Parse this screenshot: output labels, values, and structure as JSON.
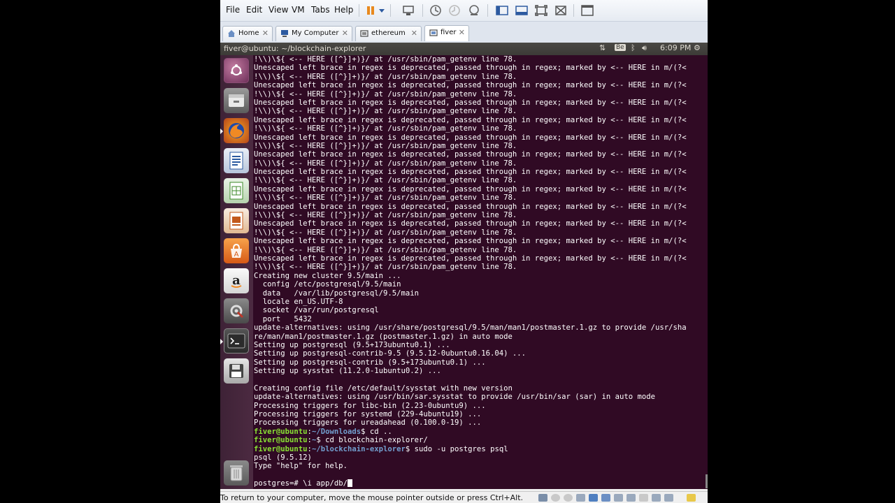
{
  "menubar": {
    "items": [
      "File",
      "Edit",
      "View",
      "VM",
      "Tabs",
      "Help"
    ],
    "toolbar_icons": [
      "pause-icon",
      "dropdown-arrow-icon",
      "send-ctrl-alt-del-icon",
      "snapshot-icon",
      "revert-snapshot-icon",
      "manage-snapshots-icon",
      "show-library-icon",
      "thumbnail-bar-icon",
      "full-screen-icon",
      "unity-icon",
      "console-view-icon"
    ]
  },
  "tabs": [
    {
      "label": "Home",
      "icon": "home-icon",
      "active": false
    },
    {
      "label": "My Computer",
      "icon": "computer-icon",
      "active": false
    },
    {
      "label": "ethereum",
      "icon": "vm-icon",
      "active": false
    },
    {
      "label": "fiver",
      "icon": "vm-icon",
      "active": true
    }
  ],
  "panel": {
    "title": "fiver@ubuntu: ~/blockchain-explorer",
    "keyboard_indicator": "Be",
    "time": "6:09 PM"
  },
  "launcher": {
    "items": [
      "ubuntu-dash-icon",
      "files-icon",
      "firefox-icon",
      "writer-icon",
      "calc-icon",
      "impress-icon",
      "software-center-icon",
      "amazon-icon",
      "system-settings-icon",
      "terminal-icon",
      "floppy-icon",
      "trash-icon"
    ]
  },
  "terminal": {
    "lines": [
      "!\\\\)\\${ <-- HERE ([^}]+)}/ at /usr/sbin/pam_getenv line 78.",
      "Unescaped left brace in regex is deprecated, passed through in regex; marked by <-- HERE in m/(?<",
      "!\\\\)\\${ <-- HERE ([^}]+)}/ at /usr/sbin/pam_getenv line 78.",
      "Unescaped left brace in regex is deprecated, passed through in regex; marked by <-- HERE in m/(?<",
      "!\\\\)\\${ <-- HERE ([^}]+)}/ at /usr/sbin/pam_getenv line 78.",
      "Unescaped left brace in regex is deprecated, passed through in regex; marked by <-- HERE in m/(?<",
      "!\\\\)\\${ <-- HERE ([^}]+)}/ at /usr/sbin/pam_getenv line 78.",
      "Unescaped left brace in regex is deprecated, passed through in regex; marked by <-- HERE in m/(?<",
      "!\\\\)\\${ <-- HERE ([^}]+)}/ at /usr/sbin/pam_getenv line 78.",
      "Unescaped left brace in regex is deprecated, passed through in regex; marked by <-- HERE in m/(?<",
      "!\\\\)\\${ <-- HERE ([^}]+)}/ at /usr/sbin/pam_getenv line 78.",
      "Unescaped left brace in regex is deprecated, passed through in regex; marked by <-- HERE in m/(?<",
      "!\\\\)\\${ <-- HERE ([^}]+)}/ at /usr/sbin/pam_getenv line 78.",
      "Unescaped left brace in regex is deprecated, passed through in regex; marked by <-- HERE in m/(?<",
      "!\\\\)\\${ <-- HERE ([^}]+)}/ at /usr/sbin/pam_getenv line 78.",
      "Unescaped left brace in regex is deprecated, passed through in regex; marked by <-- HERE in m/(?<",
      "!\\\\)\\${ <-- HERE ([^}]+)}/ at /usr/sbin/pam_getenv line 78.",
      "Unescaped left brace in regex is deprecated, passed through in regex; marked by <-- HERE in m/(?<",
      "!\\\\)\\${ <-- HERE ([^}]+)}/ at /usr/sbin/pam_getenv line 78.",
      "Unescaped left brace in regex is deprecated, passed through in regex; marked by <-- HERE in m/(?<",
      "!\\\\)\\${ <-- HERE ([^}]+)}/ at /usr/sbin/pam_getenv line 78.",
      "Unescaped left brace in regex is deprecated, passed through in regex; marked by <-- HERE in m/(?<",
      "!\\\\)\\${ <-- HERE ([^}]+)}/ at /usr/sbin/pam_getenv line 78.",
      "Unescaped left brace in regex is deprecated, passed through in regex; marked by <-- HERE in m/(?<",
      "!\\\\)\\${ <-- HERE ([^}]+)}/ at /usr/sbin/pam_getenv line 78.",
      "Creating new cluster 9.5/main ...",
      "  config /etc/postgresql/9.5/main",
      "  data   /var/lib/postgresql/9.5/main",
      "  locale en_US.UTF-8",
      "  socket /var/run/postgresql",
      "  port   5432",
      "update-alternatives: using /usr/share/postgresql/9.5/man/man1/postmaster.1.gz to provide /usr/sha",
      "re/man/man1/postmaster.1.gz (postmaster.1.gz) in auto mode",
      "Setting up postgresql (9.5+173ubuntu0.1) ...",
      "Setting up postgresql-contrib-9.5 (9.5.12-0ubuntu0.16.04) ...",
      "Setting up postgresql-contrib (9.5+173ubuntu0.1) ...",
      "Setting up sysstat (11.2.0-1ubuntu0.2) ...",
      "",
      "Creating config file /etc/default/sysstat with new version",
      "update-alternatives: using /usr/bin/sar.sysstat to provide /usr/bin/sar (sar) in auto mode",
      "Processing triggers for libc-bin (2.23-0ubuntu9) ...",
      "Processing triggers for systemd (229-4ubuntu19) ...",
      "Processing triggers for ureadahead (0.100.0-19) ..."
    ],
    "prompts": [
      {
        "user": "fiver@ubuntu",
        "path": "~/Downloads",
        "command": " cd .."
      },
      {
        "user": "fiver@ubuntu",
        "path": "~",
        "command": " cd blockchain-explorer/"
      },
      {
        "user": "fiver@ubuntu",
        "path": "~/blockchain-explorer",
        "command": " sudo -u postgres psql"
      }
    ],
    "after_lines": [
      "psql (9.5.12)",
      "Type \"help\" for help.",
      ""
    ],
    "psql_prompt": "postgres=# ",
    "current_input": "\\i app/db/"
  },
  "statusbar": {
    "text": "To return to your computer, move the mouse pointer outside or press Ctrl+Alt."
  },
  "colors": {
    "terminal_bg": "#300a24",
    "prompt_user": "#8ae234",
    "prompt_path": "#729fcf",
    "panel_bg": "#3c3b37",
    "launcher_bg": "#4c2a41"
  }
}
